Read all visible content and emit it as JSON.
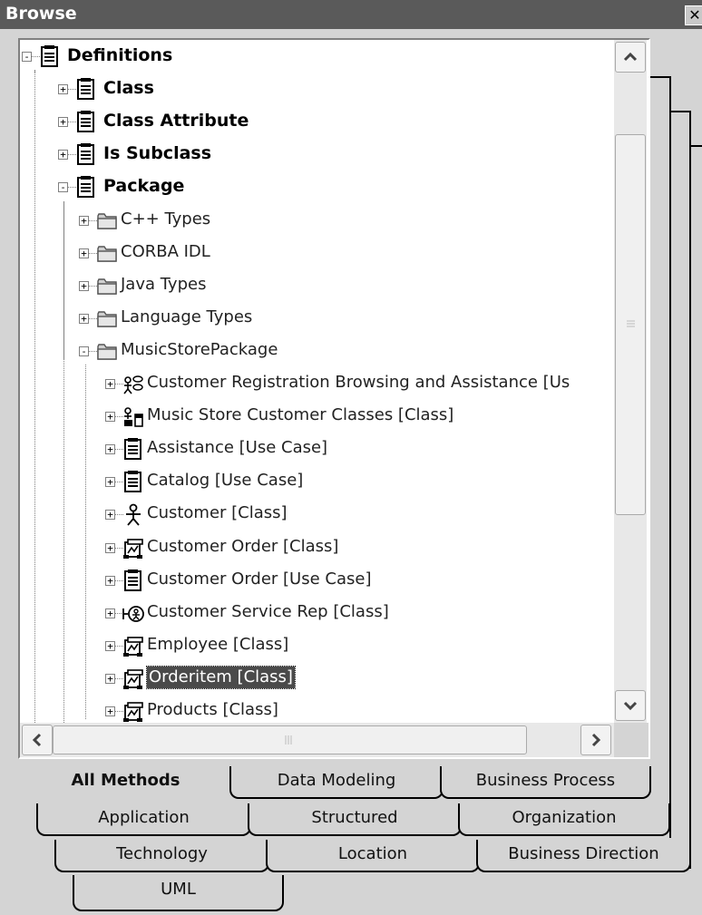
{
  "window": {
    "title": "Browse",
    "close_glyph": "✕"
  },
  "tree": [
    {
      "label": "Definitions",
      "bold": true,
      "level": 0,
      "toggle": "-",
      "icon": "document-icon"
    },
    {
      "label": "Class",
      "bold": true,
      "level": 1,
      "toggle": "+",
      "icon": "document-icon"
    },
    {
      "label": "Class Attribute",
      "bold": true,
      "level": 1,
      "toggle": "+",
      "icon": "document-icon"
    },
    {
      "label": "Is Subclass",
      "bold": true,
      "level": 1,
      "toggle": "+",
      "icon": "document-icon"
    },
    {
      "label": "Package",
      "bold": true,
      "level": 1,
      "toggle": "-",
      "icon": "document-icon"
    },
    {
      "label": "C++ Types",
      "level": 2,
      "toggle": "+",
      "icon": "folder-icon"
    },
    {
      "label": "CORBA IDL",
      "level": 2,
      "toggle": "+",
      "icon": "folder-icon"
    },
    {
      "label": "Java Types",
      "level": 2,
      "toggle": "+",
      "icon": "folder-icon"
    },
    {
      "label": "Language Types",
      "level": 2,
      "toggle": "+",
      "icon": "folder-icon"
    },
    {
      "label": "MusicStorePackage",
      "level": 2,
      "toggle": "-",
      "icon": "folder-icon"
    },
    {
      "label": "Customer Registration Browsing and Assistance  [Us",
      "level": 3,
      "toggle": "+",
      "icon": "use-case-diagram-icon"
    },
    {
      "label": "Music Store Customer Classes  [Class]",
      "level": 3,
      "toggle": "+",
      "icon": "class-diagram-icon"
    },
    {
      "label": "Assistance  [Use Case]",
      "level": 3,
      "toggle": "+",
      "icon": "document-icon"
    },
    {
      "label": "Catalog  [Use Case]",
      "level": 3,
      "toggle": "+",
      "icon": "document-icon"
    },
    {
      "label": "Customer  [Class]",
      "level": 3,
      "toggle": "+",
      "icon": "actor-icon"
    },
    {
      "label": "Customer Order  [Class]",
      "level": 3,
      "toggle": "+",
      "icon": "class-icon"
    },
    {
      "label": "Customer Order  [Use Case]",
      "level": 3,
      "toggle": "+",
      "icon": "document-icon"
    },
    {
      "label": "Customer Service Rep  [Class]",
      "level": 3,
      "toggle": "+",
      "icon": "boundary-actor-icon"
    },
    {
      "label": "Employee  [Class]",
      "level": 3,
      "toggle": "+",
      "icon": "class-icon"
    },
    {
      "label": "Orderitem  [Class]",
      "level": 3,
      "toggle": "+",
      "icon": "class-icon",
      "selected": true
    },
    {
      "label": "Products  [Class]",
      "level": 3,
      "toggle": "+",
      "icon": "class-icon"
    }
  ],
  "tabs": {
    "row1": [
      "All Methods",
      "Data Modeling",
      "Business Process"
    ],
    "row2": [
      "Application",
      "Structured",
      "Organization"
    ],
    "row3": [
      "Technology",
      "Location",
      "Business Direction"
    ],
    "row4": [
      "UML"
    ],
    "active": "All Methods"
  },
  "colors": {
    "selection": "#4a4a4a",
    "panel": "#ffffff",
    "chrome": "#d4d4d4",
    "titlebar": "#5a5a5a"
  }
}
